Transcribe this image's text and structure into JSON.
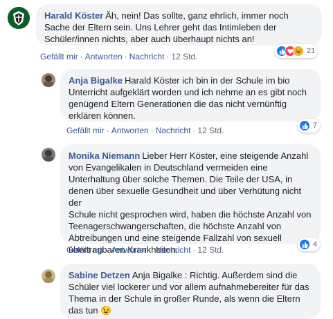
{
  "colors": {
    "link": "#385898",
    "bubble": "#f2f3f5",
    "meta": "#606770",
    "like": "#1877f2",
    "haha": "#f7b125"
  },
  "comments": [
    {
      "author": "Harald Köster",
      "text": "Äh, nein! Das sollte, ganz ehrlich, immer noch\nSache der Eltern sein. Uns Lehrer geht das Intimleben der\nSchüler/innen nichts, aber auch überhaupt nichts an!",
      "actions": {
        "like": "Gefällt mir",
        "reply": "Antworten",
        "message": "Nachricht",
        "time": "12 Std."
      },
      "reactions": {
        "icons": [
          "like-icon",
          "love-icon",
          "haha-icon"
        ],
        "count": "21"
      }
    },
    {
      "author": "Anja Bigalke",
      "text": "Harald Köster ich bin in der Schule im bio\nUnterricht aufgeklärt worden und ich nehme an es gibt noch\ngenügend Eltern Generationen die das nicht vernünftig\nerklären können.",
      "actions": {
        "like": "Gefällt mir",
        "reply": "Antworten",
        "message": "Nachricht",
        "time": "12 Std."
      },
      "reactions": {
        "icons": [
          "like-icon"
        ],
        "count": "7"
      }
    },
    {
      "author": "Monika Niemann",
      "text": "Lieber Herr Köster, eine steigende Anzahl\nvon Evangelikalen in Deutschland vermeiden eine\nUnterhaltung über solche Themen. Die Teile der USA, in\ndenen über sexuelle Gesundheit und über Verhütung nicht der\nSchule nicht gesprochen wird, haben die höchste Anzahl von\nTeenagerschwangerschaften, die höchste Anzahl von\nAbtreibungen und eine steigende Fallzahl von sexuell\nübertragbaren Krankheiten.",
      "actions": {
        "like": "Gefällt mir",
        "reply": "Antworten",
        "message": "Nachricht",
        "time": "12 Std."
      },
      "reactions": {
        "icons": [
          "like-icon"
        ],
        "count": "4"
      }
    },
    {
      "author": "Sabine Detzen",
      "text": "Anja Bigalke : Richtig. Außerdem sind die\nSchüler viel lockerer und vor allem aufnahmebereiter für das\nThema in der Schule in großer Runde, als wenn die Eltern\ndas tun 😉"
    }
  ]
}
